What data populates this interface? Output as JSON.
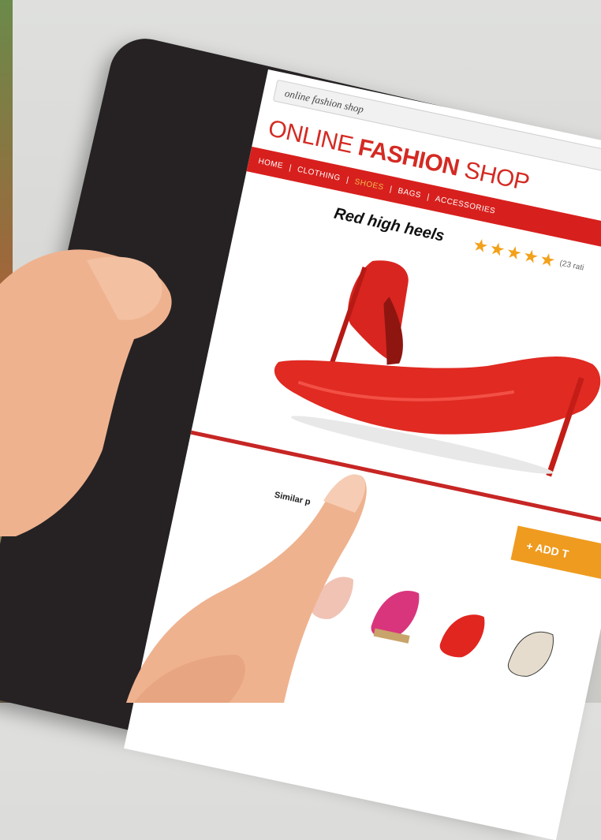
{
  "browser": {
    "url_text": "online fashion shop"
  },
  "site": {
    "logo_light": "ONLINE",
    "logo_bold": "FASHION",
    "logo_tail": "SHOP",
    "nav": [
      {
        "label": "HOME",
        "active": false
      },
      {
        "label": "CLOTHING",
        "active": false
      },
      {
        "label": "SHOES",
        "active": true
      },
      {
        "label": "BAGS",
        "active": false
      },
      {
        "label": "ACCESSORIES",
        "active": false
      }
    ]
  },
  "product": {
    "title": "Red high heels",
    "rating_stars": 5,
    "rating_note": "(23 rati",
    "add_button": "+ ADD T",
    "similar_label": "Similar p"
  },
  "colors": {
    "brand_red": "#d7201d",
    "star_orange": "#f3a11b",
    "button_orange": "#ef9b1f",
    "tablet_black": "#262223"
  }
}
